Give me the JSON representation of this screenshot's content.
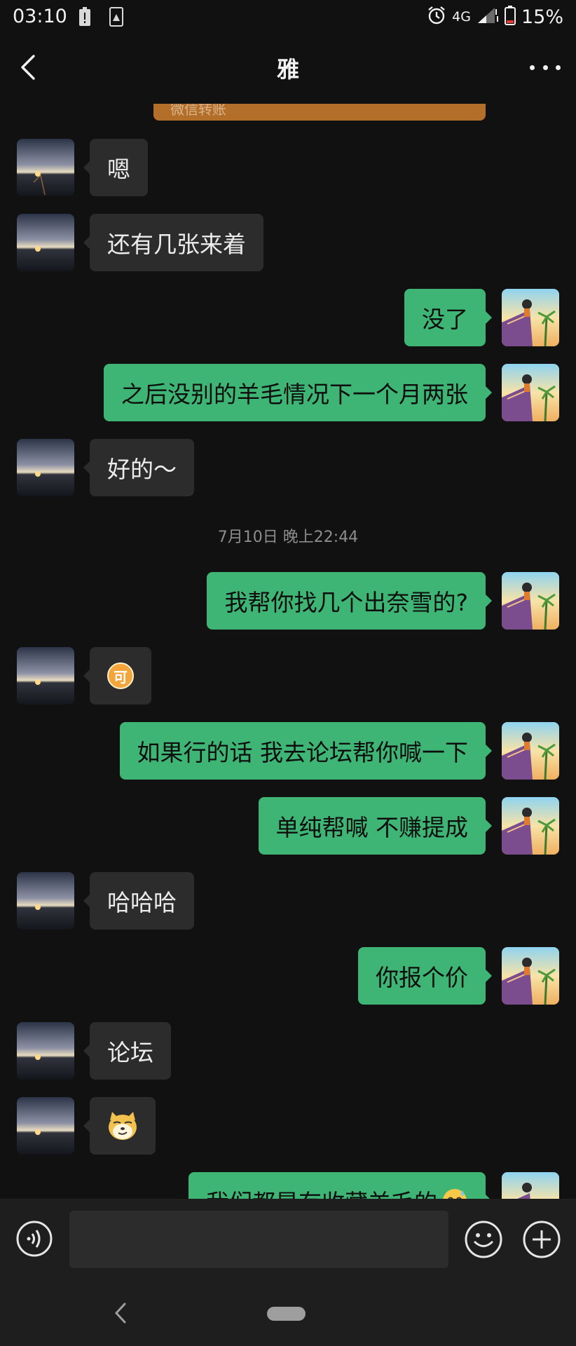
{
  "status_bar": {
    "time": "03:10",
    "network": "4G",
    "battery": "15%"
  },
  "header": {
    "title": "雅"
  },
  "transfer_card": {
    "label": "微信转账"
  },
  "messages": [
    {
      "side": "in",
      "text": "嗯"
    },
    {
      "side": "in",
      "text": "还有几张来着"
    },
    {
      "side": "out",
      "text": "没了"
    },
    {
      "side": "out",
      "text": "之后没别的羊毛情况下一个月两张"
    },
    {
      "side": "in",
      "text": "好的～"
    },
    {
      "timestamp": "7月10日 晚上22:44"
    },
    {
      "side": "out",
      "text": "我帮你找几个出奈雪的?"
    },
    {
      "side": "in",
      "emoji": "coin-emoji",
      "emoji_text": "可"
    },
    {
      "side": "out",
      "text": "如果行的话 我去论坛帮你喊一下"
    },
    {
      "side": "out",
      "text": "单纯帮喊 不赚提成"
    },
    {
      "side": "in",
      "text": "哈哈哈"
    },
    {
      "side": "out",
      "text": "你报个价"
    },
    {
      "side": "in",
      "text": "论坛"
    },
    {
      "side": "in",
      "emoji": "smirking-doge-emoji"
    },
    {
      "side": "out",
      "text": "我们都是有收藏羊毛的"
    }
  ],
  "colors": {
    "background": "#111111",
    "incoming_bubble": "#2c2c2c",
    "outgoing_bubble": "#3eb575",
    "transfer_card": "#b36e2a"
  },
  "icons": {
    "voice": "voice-input-icon",
    "emoji": "emoji-icon",
    "plus": "plus-icon",
    "back": "back-arrow-icon",
    "more": "more-dots-icon"
  }
}
